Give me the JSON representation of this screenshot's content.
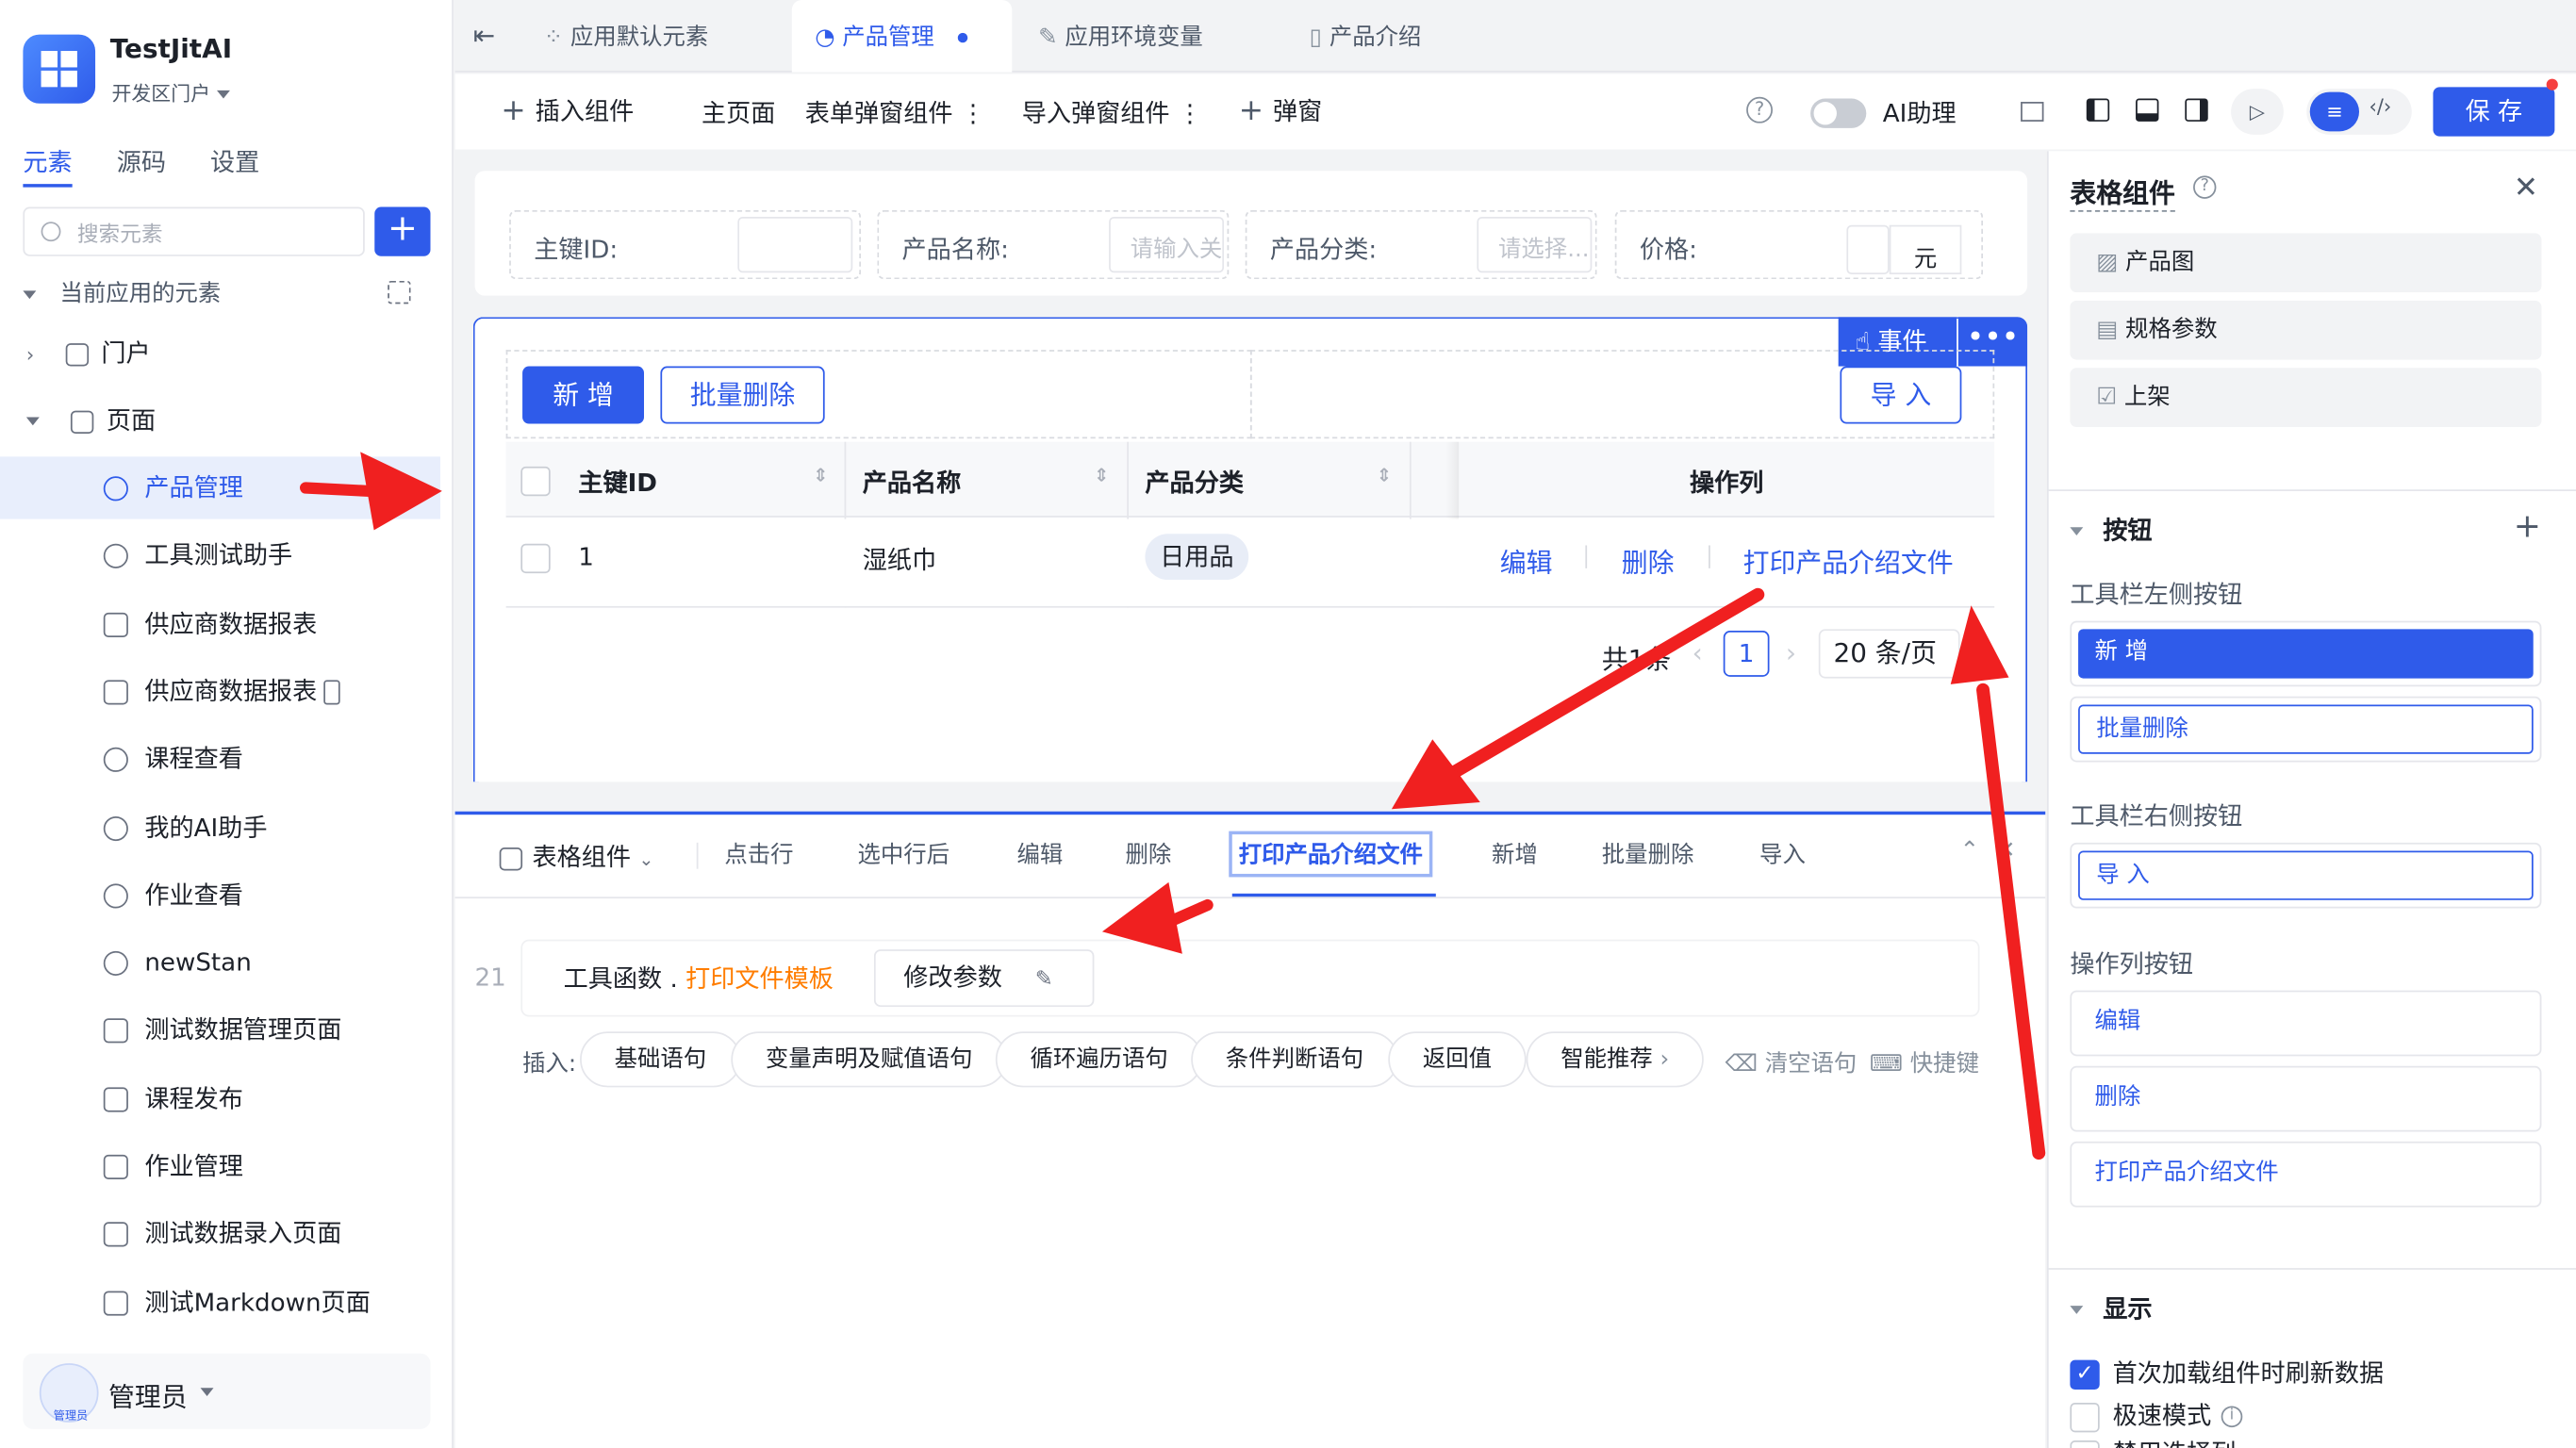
{
  "app": {
    "name": "TestJitAI",
    "portal": "开发区门户"
  },
  "sidebar": {
    "tabs": [
      "元素",
      "源码",
      "设置"
    ],
    "search_placeholder": "搜索元素",
    "section_title": "当前应用的元素",
    "tree": {
      "portal": "门户",
      "pages": "页面"
    },
    "items": [
      "产品管理",
      "工具测试助手",
      "供应商数据报表",
      "供应商数据报表",
      "课程查看",
      "我的AI助手",
      "作业查看",
      "newStan",
      "测试数据管理页面",
      "课程发布",
      "作业管理",
      "测试数据录入页面",
      "测试Markdown页面"
    ],
    "user": {
      "name": "管理员",
      "avatar_label": "管理员"
    }
  },
  "top_tabs": [
    "应用默认元素",
    "产品管理",
    "应用环境变量",
    "产品介绍"
  ],
  "toolbar": {
    "insert": "插入组件",
    "main_page": "主页面",
    "form_modal": "表单弹窗组件",
    "import_modal": "导入弹窗组件",
    "modal": "弹窗",
    "ai": "AI助理",
    "save": "保 存"
  },
  "filter": {
    "f1": "主键ID:",
    "f2": "产品名称:",
    "f2_ph": "请输入关",
    "f3": "产品分类:",
    "f3_ph": "请选择...",
    "f4": "价格:",
    "f4_unit": "元"
  },
  "table": {
    "event_label": "事件",
    "add": "新 增",
    "batch_delete": "批量删除",
    "import": "导 入",
    "headers": [
      "主键ID",
      "产品名称",
      "产品分类",
      "操作列"
    ],
    "row": {
      "id": "1",
      "name": "湿纸巾",
      "category": "日用品",
      "actions": [
        "编辑",
        "删除",
        "打印产品介绍文件"
      ]
    },
    "pager": {
      "total": "共1条",
      "page": "1",
      "size": "20 条/页"
    }
  },
  "bottom": {
    "component": "表格组件",
    "tabs": [
      "点击行",
      "选中行后",
      "编辑",
      "删除",
      "打印产品介绍文件",
      "新增",
      "批量删除",
      "导入"
    ],
    "line_no": "21",
    "code_prefix": "工具函数 . ",
    "code_func": "打印文件模板",
    "edit_param": "修改参数",
    "insert_label": "插入:",
    "chips": [
      "基础语句",
      "变量声明及赋值语句",
      "循环遍历语句",
      "条件判断语句",
      "返回值",
      "智能推荐"
    ],
    "clear": "清空语句",
    "shortcut": "快捷键"
  },
  "right": {
    "title": "表格组件",
    "fields": [
      "产品图",
      "规格参数",
      "上架"
    ],
    "buttons_section": "按钮",
    "left_toolbar": "工具栏左侧按钮",
    "left_btns": [
      "新 增",
      "批量删除"
    ],
    "right_toolbar": "工具栏右侧按钮",
    "right_btns": [
      "导 入"
    ],
    "op_col": "操作列按钮",
    "op_btns": [
      "编辑",
      "删除",
      "打印产品介绍文件"
    ],
    "display_section": "显示",
    "opt1": "首次加载组件时刷新数据",
    "opt2": "极速模式",
    "opt3": "禁用选择列"
  },
  "colors": {
    "primary": "#2f5bea",
    "annotation": "#f02020",
    "orange": "#ff7d00"
  }
}
